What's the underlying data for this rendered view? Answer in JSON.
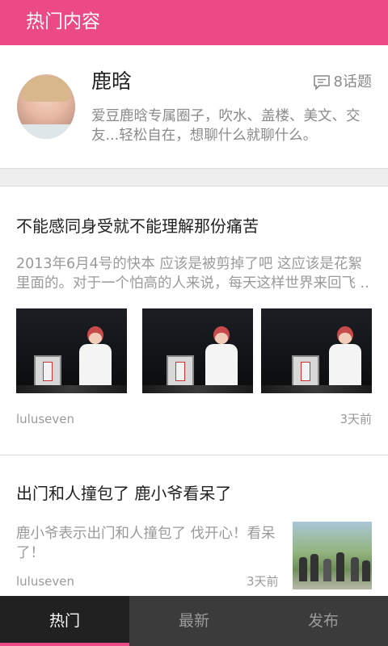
{
  "header": {
    "title": "热门内容"
  },
  "profile": {
    "name": "鹿晗",
    "topics": "8话题",
    "description": "爱豆鹿晗专属圈子，吹水、盖楼、美文、交友...轻松自在，想聊什么就聊什么。"
  },
  "posts": [
    {
      "title": "不能感同身受就不能理解那份痛苦",
      "excerpt": "2013年6月4号的快本 应该是被剪掉了吧 这应该是花絮里面的。对于一个怕高的人来说，每天这样世界来回飞 ..",
      "images": [
        "video-still-1",
        "video-still-2",
        "video-still-3"
      ],
      "author": "luluseven",
      "time": "3天前"
    },
    {
      "title": "出门和人撞包了 鹿小爷看呆了",
      "excerpt": "鹿小爷表示出门和人撞包了 伐开心！看呆了！",
      "author": "luluseven",
      "time": "3天前"
    }
  ],
  "tabs": [
    {
      "label": "热门",
      "active": true
    },
    {
      "label": "最新",
      "active": false
    },
    {
      "label": "发布",
      "active": false
    }
  ],
  "colors": {
    "accent": "#ec4a86",
    "tabbar": "#3b3b3b",
    "tab_active": "#212121"
  }
}
